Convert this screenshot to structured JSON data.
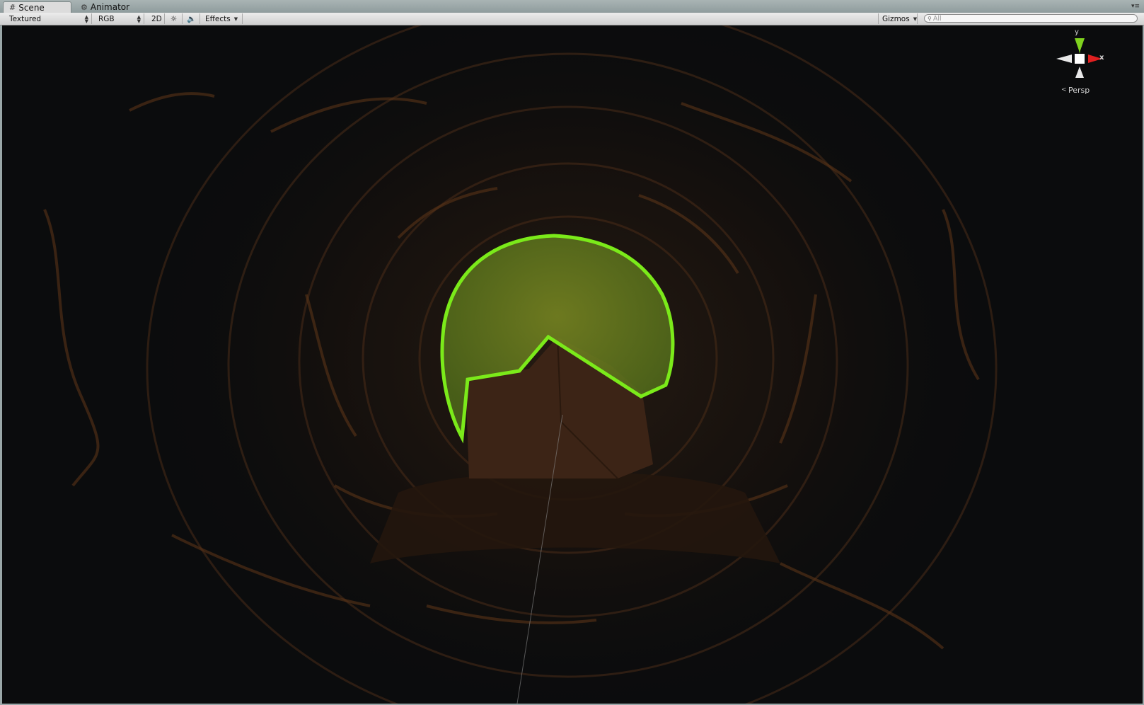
{
  "tabs": [
    {
      "label": "Scene",
      "icon": "grid-icon",
      "active": true
    },
    {
      "label": "Animator",
      "icon": "animator-icon",
      "active": false
    }
  ],
  "toolbar": {
    "draw_mode": "Textured",
    "render_mode": "RGB",
    "toggle_2d": "2D",
    "effects_label": "Effects",
    "gizmos_label": "Gizmos",
    "search_placeholder": "All"
  },
  "scene_gizmo": {
    "y_axis": "y",
    "x_axis": "x",
    "projection": "Persp"
  },
  "colors": {
    "selection_outline": "#7bea1a",
    "cave_brown": "#3d2616",
    "background": "#0b0c0d"
  }
}
